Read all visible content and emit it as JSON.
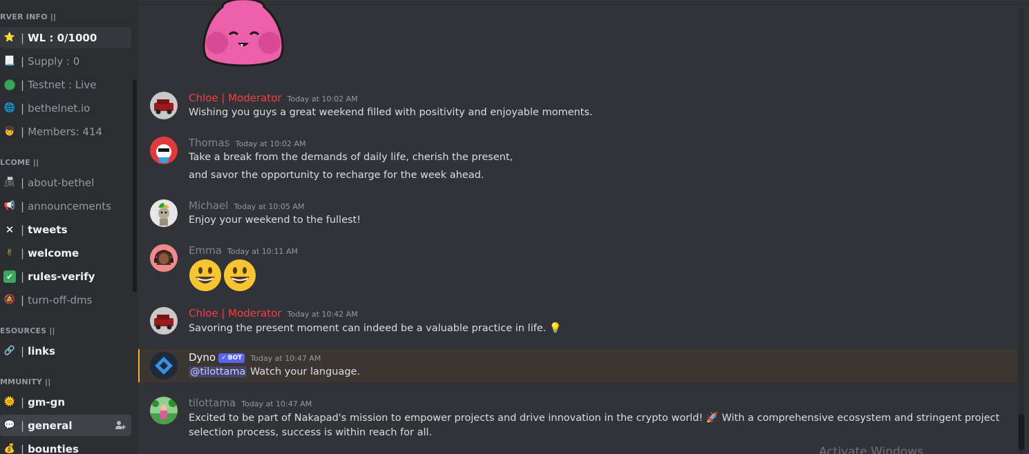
{
  "sidebar": {
    "categories": {
      "server_info": "RVER INFO ||",
      "welcome": "LCOME ||",
      "resources": "ESOURCES ||",
      "community": "MMUNITY ||"
    },
    "channels": {
      "wl": {
        "emoji": "⭐",
        "label": "WL : 0/1000"
      },
      "supply": {
        "emoji": "📃",
        "label": "Supply : 0"
      },
      "testnet": {
        "emoji": "🟢",
        "label": "Testnet : Live"
      },
      "site": {
        "emoji": "🌐",
        "label": "bethelnet.io"
      },
      "members": {
        "emoji": "👦",
        "label": "Members: 414"
      },
      "about": {
        "emoji": "📠",
        "label": "about-bethel"
      },
      "announcements": {
        "emoji": "📢",
        "label": "announcements"
      },
      "tweets": {
        "emoji": "✕",
        "label": "tweets"
      },
      "welcome": {
        "emoji": "✌",
        "label": "welcome"
      },
      "rules": {
        "emoji": "✔",
        "label": "rules-verify"
      },
      "dms": {
        "emoji": "🔕",
        "label": "turn-off-dms"
      },
      "links": {
        "emoji": "🔗",
        "label": "links"
      },
      "gmgn": {
        "emoji": "🌞",
        "label": "gm-gn"
      },
      "general": {
        "emoji": "💬",
        "label": "general"
      },
      "bounties": {
        "emoji": "💰",
        "label": "bounties"
      }
    },
    "separator": "|"
  },
  "messages": [
    {
      "user": "Chloe | Moderator",
      "time": "Today at 10:02 AM",
      "lines": [
        "Wishing you guys a great weekend filled with positivity and enjoyable moments."
      ],
      "color": "#f23f42"
    },
    {
      "user": "Thomas",
      "time": "Today at 10:02 AM",
      "lines": [
        "Take a break from the demands of daily life, cherish the present,",
        "and savor the opportunity to recharge for the week ahead."
      ],
      "color": "#80848e"
    },
    {
      "user": "Michael",
      "time": "Today at 10:05 AM",
      "lines": [
        "Enjoy your weekend to the fullest!"
      ],
      "color": "#80848e"
    },
    {
      "user": "Emma",
      "time": "Today at 10:11 AM",
      "lines": [],
      "emojis": "😃😃",
      "color": "#80848e"
    },
    {
      "user": "Chloe | Moderator",
      "time": "Today at 10:42 AM",
      "lines": [
        "Savoring the present moment can indeed be a valuable practice in life. 💡"
      ],
      "color": "#f23f42"
    },
    {
      "user": "Dyno",
      "badge": "BOT",
      "time": "Today at 10:47 AM",
      "mention": "@tilottama",
      "lines": [
        " Watch your language."
      ],
      "color": "#f2f3f5"
    },
    {
      "user": "tilottama",
      "time": "Today at 10:47 AM",
      "lines": [
        "Excited to be part of Nakapad's mission to empower projects and drive innovation in the crypto world! 🚀 With a comprehensive ecosystem and stringent project",
        "selection process, success is within reach for all."
      ],
      "color": "#80848e"
    }
  ],
  "watermark": "Activate Windows",
  "colors": {
    "moderator": "#f23f42",
    "default_user": "#80848e",
    "bot_badge": "#5865f2",
    "highlight_bar": "#f0b232"
  }
}
